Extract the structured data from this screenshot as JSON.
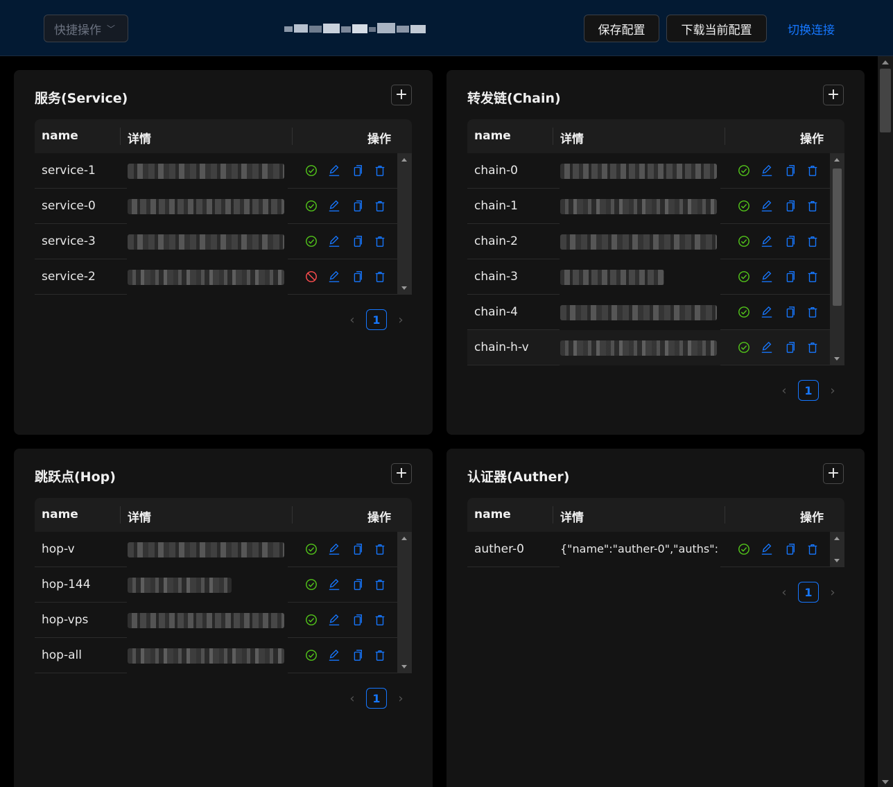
{
  "header": {
    "quick_label": "快捷操作",
    "save_label": "保存配置",
    "download_label": "下载当前配置",
    "switch_label": "切换连接"
  },
  "colors": {
    "ok": "#52c41a",
    "disabled": "#ff4d4f",
    "accent": "#1677ff"
  },
  "columns": {
    "name": "name",
    "detail": "详情",
    "ops": "操作"
  },
  "service": {
    "title": "服务(Service)",
    "rows": [
      {
        "name": "service-1",
        "status": "ok"
      },
      {
        "name": "service-0",
        "status": "ok"
      },
      {
        "name": "service-3",
        "status": "ok"
      },
      {
        "name": "service-2",
        "status": "disabled"
      }
    ],
    "page": "1"
  },
  "chain": {
    "title": "转发链(Chain)",
    "rows": [
      {
        "name": "chain-0",
        "status": "ok"
      },
      {
        "name": "chain-1",
        "status": "ok"
      },
      {
        "name": "chain-2",
        "status": "ok"
      },
      {
        "name": "chain-3",
        "status": "ok"
      },
      {
        "name": "chain-4",
        "status": "ok"
      },
      {
        "name": "chain-h-v",
        "status": "ok"
      }
    ],
    "page": "1"
  },
  "hop": {
    "title": "跳跃点(Hop)",
    "rows": [
      {
        "name": "hop-v",
        "status": "ok"
      },
      {
        "name": "hop-144",
        "status": "ok"
      },
      {
        "name": "hop-vps",
        "status": "ok"
      },
      {
        "name": "hop-all",
        "status": "ok"
      }
    ],
    "page": "1"
  },
  "auther": {
    "title": "认证器(Auther)",
    "rows": [
      {
        "name": "auther-0",
        "detail": "{\"name\":\"auther-0\",\"auths\":[...",
        "status": "ok"
      }
    ],
    "page": "1"
  }
}
